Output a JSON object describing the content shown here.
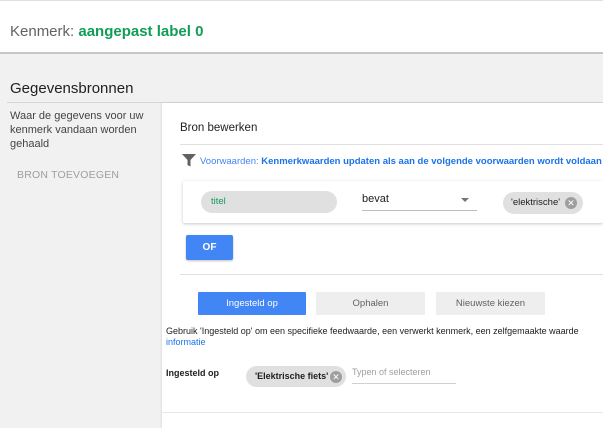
{
  "header": {
    "label": "Kenmerk: ",
    "name": "aangepast label 0"
  },
  "data_sources": {
    "title": "Gegevensbronnen",
    "description": "Waar de gegevens voor uw kenmerk vandaan worden gehaald",
    "add_source": "BRON TOEVOEGEN"
  },
  "editor": {
    "title": "Bron bewerken",
    "condition_label": "Voorwaarden: ",
    "condition_text": "Kenmerkwaarden updaten als aan de volgende voorwaarden wordt voldaan",
    "rule": {
      "field": "titel",
      "operator": "bevat",
      "value": "'elektrische'"
    },
    "or_button": "OF",
    "tabs": [
      "Ingesteld op",
      "Ophalen",
      "Nieuwste kiezen"
    ],
    "help_text": "Gebruik 'Ingesteld op' om een specifieke feedwaarde, een verwerkt kenmerk, een zelfgemaakte waarde",
    "help_link": "informatie",
    "set_label": "Ingesteld op",
    "set_value": "'Elektrische fiets'",
    "set_placeholder": "Typen of selecteren"
  },
  "colors": {
    "accent": "#4285f4",
    "brand_green": "#0f9d58"
  }
}
